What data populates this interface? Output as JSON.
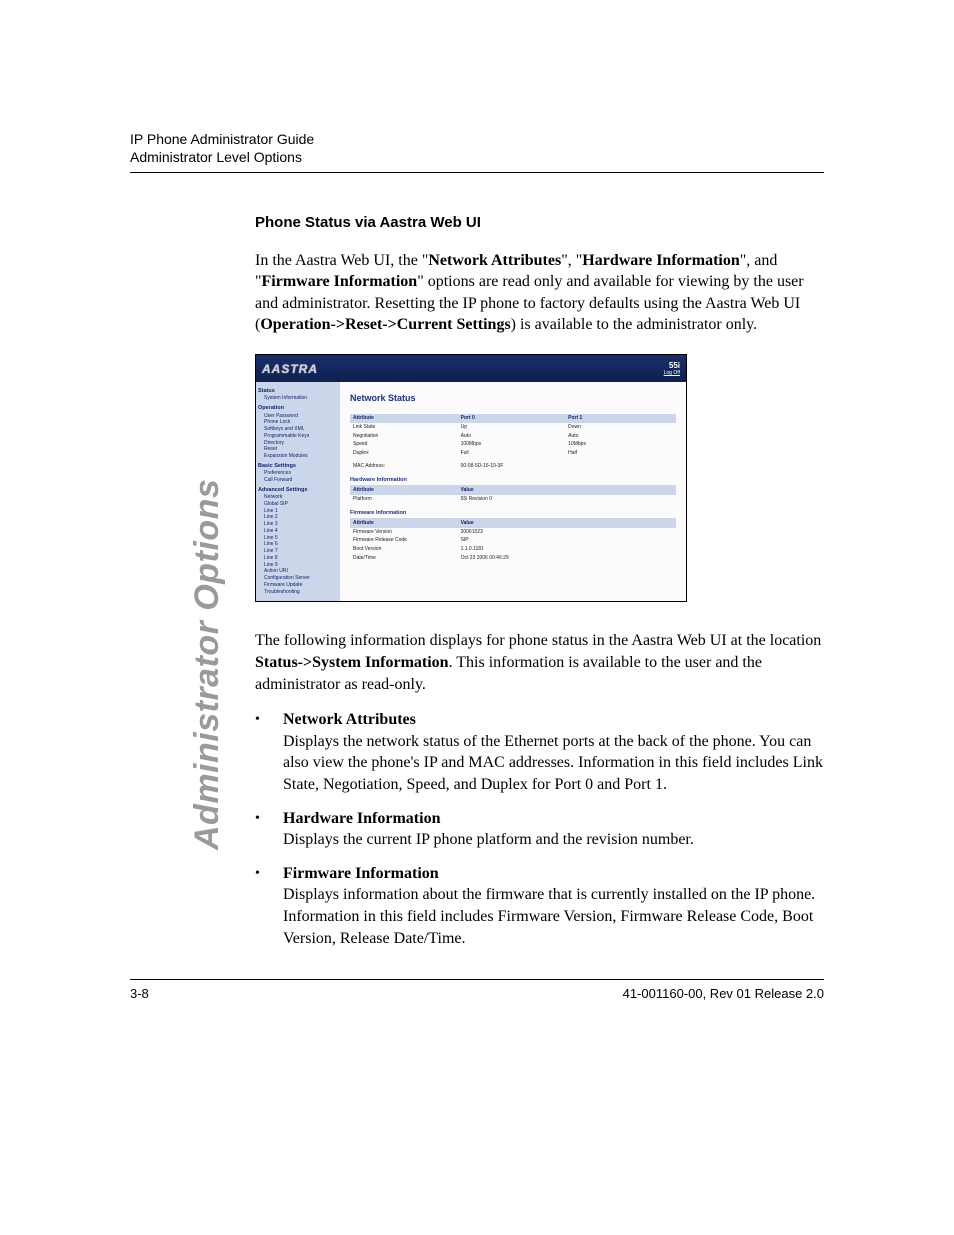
{
  "header": {
    "line1": "IP Phone Administrator Guide",
    "line2": "Administrator Level Options"
  },
  "side_tab": "Administrator Options",
  "section_title": "Phone Status via Aastra Web UI",
  "para1_parts": {
    "t1": "In the Aastra Web UI, the \"",
    "b1": "Network Attributes",
    "t2": "\", \"",
    "b2": "Hardware Information",
    "t3": "\", and \"",
    "b3": "Firmware Information",
    "t4": "\" options are read only and available for viewing by the user and administrator. Resetting the IP phone to factory defaults using the Aastra Web UI (",
    "b4": "Operation->Reset->Current Settings",
    "t5": ") is available to the administrator only."
  },
  "screenshot": {
    "logo": "AASTRA",
    "model": "55i",
    "logoff": "Log Off",
    "sidebar": {
      "status": "Status",
      "status_items": [
        "System Information"
      ],
      "operation": "Operation",
      "operation_items": [
        "User Password",
        "Phone Lock",
        "Softkeys and XML",
        "Programmable Keys",
        "Directory",
        "Reset",
        "Expansion Modules"
      ],
      "basic": "Basic Settings",
      "basic_items": [
        "Preferences",
        "Call Forward"
      ],
      "advanced": "Advanced Settings",
      "advanced_items": [
        "Network",
        "Global SIP",
        "Line 1",
        "Line 2",
        "Line 3",
        "Line 4",
        "Line 5",
        "Line 6",
        "Line 7",
        "Line 8",
        "Line 9",
        "Action URI",
        "Configuration Server",
        "Firmware Update",
        "Troubleshooting"
      ]
    },
    "main": {
      "title": "Network Status",
      "net_headers": [
        "Attribute",
        "Port 0",
        "Port 1"
      ],
      "net_rows": [
        [
          "Link State",
          "Up",
          "Down"
        ],
        [
          "Negotiation",
          "Auto",
          "Auto"
        ],
        [
          "Speed",
          "100Mbps",
          "10Mbps"
        ],
        [
          "Duplex",
          "Full",
          "Half"
        ]
      ],
      "mac_label": "MAC Address:",
      "mac_value": "00-08-5D-16-10-3F",
      "hw_title": "Hardware Information",
      "hw_headers": [
        "Attribute",
        "Value"
      ],
      "hw_rows": [
        [
          "Platform",
          "55i Revision 0"
        ]
      ],
      "fw_title": "Firmware Information",
      "fw_headers": [
        "Attribute",
        "Value"
      ],
      "fw_rows": [
        [
          "Firmware Version",
          "20061023"
        ],
        [
          "Firmware Release Code",
          "SIP"
        ],
        [
          "Boot Version",
          "1.1.0.1181"
        ],
        [
          "Date/Time",
          "Oct 23 2006 00:46:29"
        ]
      ]
    }
  },
  "para2_parts": {
    "t1": "The following information displays for phone status in the Aastra Web UI at the location ",
    "b1": "Status->System Information",
    "t2": ". This information is available to the user and the administrator as read-only."
  },
  "bullets": [
    {
      "marker": "•",
      "title": "Network Attributes",
      "body": "Displays the network status of the Ethernet ports at the back of the phone. You can also view the phone's IP and MAC addresses. Information in this field includes Link State, Negotiation, Speed, and Duplex for Port 0 and Port 1."
    },
    {
      "marker": "•",
      "title": "Hardware Information",
      "body": "Displays the current IP phone platform and the revision number."
    },
    {
      "marker": "•",
      "title": "Firmware Information",
      "body": "Displays information about the firmware that is currently installed on the IP phone. Information in this field includes Firmware Version, Firmware Release Code, Boot Version, Release Date/Time."
    }
  ],
  "footer": {
    "left": "3-8",
    "right": "41-001160-00, Rev 01 Release 2.0"
  }
}
